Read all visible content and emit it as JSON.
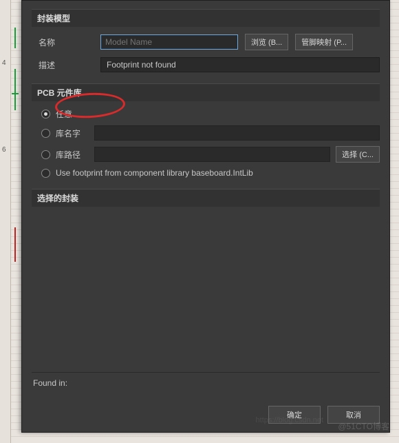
{
  "sections": {
    "model": "封装模型",
    "library": "PCB 元件库",
    "selected": "选择的封装"
  },
  "model": {
    "name_label": "名称",
    "name_placeholder": "Model Name",
    "name_value": "",
    "desc_label": "描述",
    "desc_value": "Footprint not found",
    "browse_btn": "浏览 (B...",
    "pinmap_btn": "管脚映射 (P..."
  },
  "library": {
    "options": {
      "any": "任意",
      "libname": "库名字",
      "libpath": "库路径",
      "use_baseboard": "Use footprint from component library baseboard.IntLib"
    },
    "selected": "any",
    "libname_value": "",
    "libpath_value": "",
    "choose_btn": "选择 (C..."
  },
  "footer": {
    "found_in_label": "Found in:",
    "ok": "确定",
    "cancel": "取消"
  },
  "ruler_ticks": [
    "4",
    "6"
  ],
  "watermark_right": "@51CTO博客",
  "watermark_left": "https://blog.csdn.net"
}
